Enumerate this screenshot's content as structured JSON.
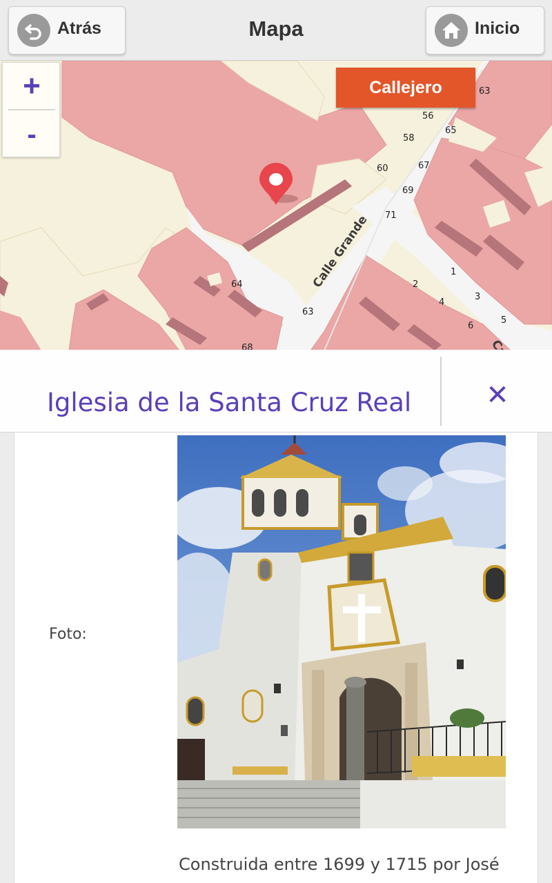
{
  "header": {
    "back_label": "Atrás",
    "title": "Mapa",
    "home_label": "Inicio"
  },
  "map": {
    "zoom_in": "+",
    "zoom_out": "-",
    "callejero_label": "Callejero",
    "street_labels": [
      "Calle Grande",
      "Calle Rosario"
    ],
    "house_numbers": [
      "56",
      "58",
      "60",
      "63",
      "65",
      "67",
      "69",
      "71",
      "64",
      "63",
      "68",
      "1",
      "2",
      "3",
      "4",
      "5",
      "6"
    ],
    "colors": {
      "building": "#eba6a6",
      "building_dark": "#b5757a",
      "open_area": "#f6f1dc",
      "street": "#f5f5f5",
      "marker": "#e8454c"
    }
  },
  "info": {
    "title": "Iglesia de la Santa Cruz Real",
    "close_icon": "close-icon"
  },
  "details": {
    "photo_label": "Foto:",
    "description": "Construida entre 1699 y 1715 por José"
  }
}
